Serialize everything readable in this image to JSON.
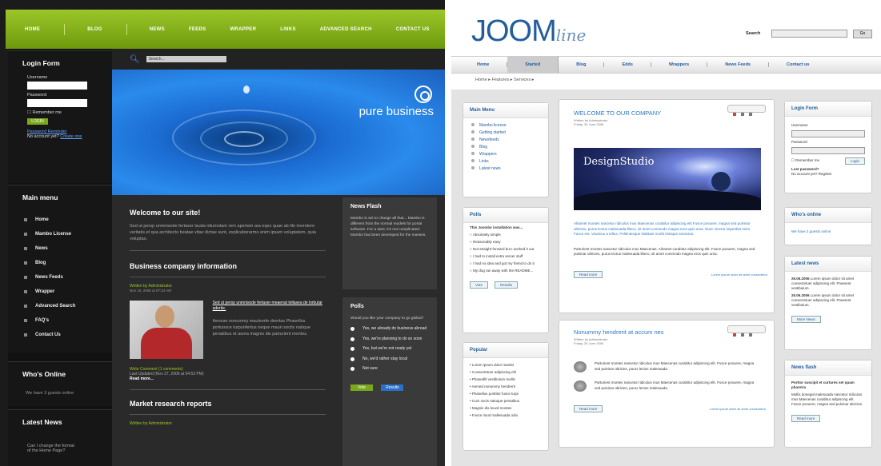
{
  "left_site": {
    "nav": [
      "HOME",
      "BLOG",
      "NEWS",
      "FEEDS",
      "WRAPPER",
      "LINKS",
      "ADVANCED SEARCH",
      "CONTACT US"
    ],
    "login": {
      "title": "Login Form",
      "username_label": "Username",
      "password_label": "Password",
      "remember": "Remember me",
      "login_btn": "LOGIN",
      "forgot": "Password Reminder",
      "no_account": "No account yet?",
      "create": "Create one"
    },
    "search_placeholder": "Search...",
    "brand": "pure business",
    "main_menu": {
      "title": "Main menu",
      "items": [
        "Home",
        "Mambo License",
        "News",
        "Blog",
        "News Feeds",
        "Wrapper",
        "Advanced Search",
        "FAQ's",
        "Contact Us"
      ]
    },
    "whos_online": {
      "title": "Who's Online",
      "text": "We have 3 guests online"
    },
    "latest_news": {
      "title": "Latest News",
      "item1": "Can I change the format",
      "item2": "of the Home Page?"
    },
    "welcome": {
      "title": "Welcome to our site!",
      "text": "Sed ut persp unmnisode fertaser lauda ntiumotam rem aperiam ara eqes quae ab illo inventore veritatis et qua architecto beatae vitae dictae sunt, explicaborarmo enim ipsam voluptatem, quia voluptas."
    },
    "biz": {
      "title": "Business company information",
      "byline": "Written by Administrator",
      "date": "Nov 19, 2006 at 07:24 AM",
      "link": "Sed ut persp unmnisode fertaser meaenat tellasea de lorbutar adertie.",
      "text": "Aenean nonummy mauleorfe deertas Phasellus portuosce turpunfertus neque mauri soctis natique penatibus et asora magnis dis parturient montes.",
      "comment": "Write Comment (1 comments)",
      "updated": "Last Updated (Nov 27, 2006 at 04:53 PM)",
      "more": "Read more..."
    },
    "market": {
      "title": "Market research reports",
      "byline": "Written by Administrator"
    },
    "news_flash": {
      "title": "News Flash",
      "text": "Mambo is set to change all that... Mambo is different from the normal models for portal software. For a start, it's not complicated. Mambo has been developed for the masses."
    },
    "polls": {
      "title": "Polls",
      "question": "Would you like your company to go global?",
      "options": [
        "Yes, we already do business abroad",
        "Yes, we're planning to do so soon",
        "Yes, but we're not ready yet",
        "No, we'd rather stay local",
        "Not sure"
      ],
      "vote": "Vote",
      "results": "Results"
    },
    "colors": {
      "green": "#7aa81a",
      "dark": "#1b1b1b"
    }
  },
  "right_site": {
    "logo_main": "JOOM",
    "logo_script": "line",
    "search_label": "Search",
    "go": "Go",
    "nav": [
      "Home",
      "Started",
      "Blog",
      "Edds",
      "Wrappers",
      "News Feeds",
      "Contact us"
    ],
    "subnav": "Home ▸    Features ▸    Services ▸",
    "main_menu": {
      "title": "Main Menu",
      "items": [
        "Mambo license",
        "Getting started",
        "Newsfeeds",
        "Blog",
        "Wrappers",
        "Links",
        "Latest news"
      ]
    },
    "polls": {
      "title": "Polls",
      "question": "This Joomla! installation was...",
      "options": [
        "Absolutely simple",
        "Reasonably easy",
        "Not straight-forward but I worked it out",
        "I had to install extra server stuff",
        "I had no idea and got my friend to do it",
        "My dog ran away with the README..."
      ],
      "vote": "Vote",
      "results": "Results"
    },
    "popular": {
      "title": "Popular",
      "items": [
        "Lorem ipsum dolor mamitt",
        "Consectetuer adipiscing elit",
        "Phasedlit vestibulum mollis",
        "Aemed nonummy hendrerit",
        "Phasellus porttitor fusce turpi",
        "Cum socis natoque penatibus",
        "Magnis dis leuvd montes",
        "Fusce risud mallesuada odio"
      ]
    },
    "welcome": {
      "title": "WELCOME TO OUR COMPANY",
      "byline": "Written by Administrator",
      "date": "Friday, 30 June 2006",
      "banner": "DesignStudio",
      "text1": "Aliramet montes nascetur ridiculus mus Maecenas curabitur adipiscing elit Fusce posuere, magna sed pulvinar ultricies, purus lectus malesuada libero, sit amet commodo magna eros quis urna. Nunc viverra imperdiet enim. Fusce est. Vivamus a tellus. Pellentesque habitant morbi tristique senectus.",
      "text2": "Parturient montes nascetur ridiculus mus Maecenas. Aliramet curabitur adipiscing elit. Fusce posuere, magna sed pulvinar ultricies, purus lectus malesuada libero, sit amet commodo magna eros quis urna.",
      "read_more": "Read more",
      "link": "Lorem ipsum dolor sit amet consectetur"
    },
    "second": {
      "title": "Nonummy hendrerit at accum nes",
      "byline": "Written by Administrator",
      "date": "Friday, 30 June 2006",
      "text": "Parturient montes nascetur ridiculus mus Maecenas curabitur adipiscing elit. Fusce posuere, magna sed pulvinar ultricies, purus lectus malesuada.",
      "read_more": "Read more",
      "link": "Lorem ipsum dolor sit amet consectetur"
    },
    "login": {
      "title": "Login Form",
      "username": "Username",
      "password": "Password",
      "remember": "Remember me",
      "login_btn": "Login",
      "lost": "Lost password?",
      "no_account": "No account yet? Register"
    },
    "whos_online": {
      "title": "Who's online",
      "text": "We have 2 guests online"
    },
    "latest_news": {
      "title": "Latest news",
      "date1": "26.06.2006",
      "text1": "Lorem ipsum dolor sit amet consectetuer adipiscing elit. Praesent vestibulum.",
      "date2": "25.06.2006",
      "text2": "Lorem ipsum dolor sit amet consectetuer adipiscing elit. Praesent vestibulum.",
      "more": "More News"
    },
    "news_flash": {
      "title": "News flash",
      "head": "Porttor suscipit et curtures set quam pharetra",
      "text": "Mollis donegal malesuada nascetur ridiculus mus Maecenas curabitur adipiscing elit. Fusce posuere, magna sed pulvinar ultricies.",
      "read_more": "Read more"
    },
    "colors": {
      "blue": "#235d9c",
      "panel_bg": "#e3e3e3"
    }
  }
}
